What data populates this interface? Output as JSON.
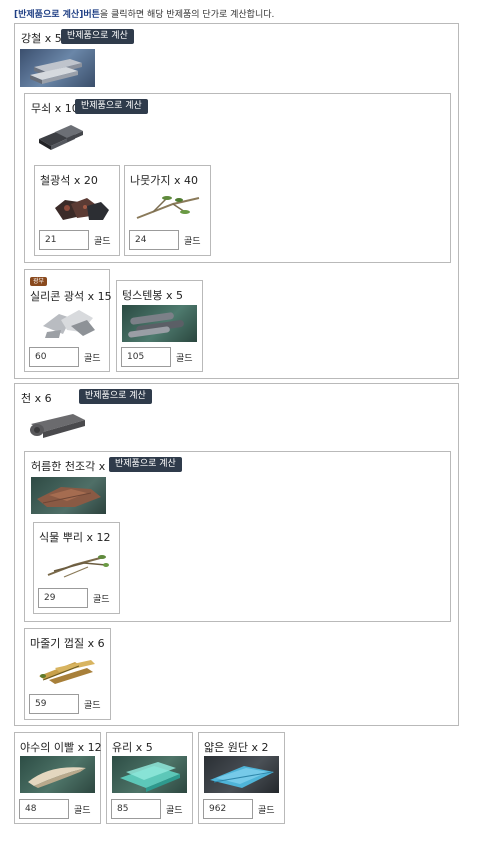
{
  "notice": {
    "bold": "[반제품으로 계산]",
    "bold2": "버튼",
    "text": "을 클릭하면 해당 반제품의 단가로 계산합니다."
  },
  "calc_button_label": "반제품으로 계산",
  "unit_label": "골드",
  "steel": {
    "title": "강철 x 5"
  },
  "pigiron": {
    "title": "무쇠 x 10"
  },
  "ironore": {
    "title": "철광석 x 20",
    "price": "21"
  },
  "branch": {
    "title": "나뭇가지 x 40",
    "price": "24"
  },
  "silicon": {
    "title": "실리콘 광석 x 15",
    "price": "60",
    "badge": "광부"
  },
  "tungsten": {
    "title": "텅스텐봉 x 5",
    "price": "105"
  },
  "cloth": {
    "title": "천 x 6"
  },
  "oldcloth": {
    "title": "허름한 천조각 x 6"
  },
  "root": {
    "title": "식물 뿌리 x 12",
    "price": "29"
  },
  "hemp": {
    "title": "마줄기 껍질 x 6",
    "price": "59"
  },
  "tooth": {
    "title": "야수의 이빨 x 12",
    "price": "48"
  },
  "glass": {
    "title": "유리 x 5",
    "price": "85"
  },
  "fabric": {
    "title": "얇은 원단 x 2",
    "price": "962"
  }
}
